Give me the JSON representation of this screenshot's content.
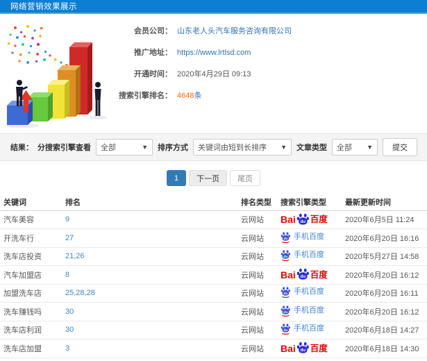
{
  "header": {
    "title": "网络营销效果展示"
  },
  "info": {
    "company_label": "会员公司：",
    "company_value": "山东老人头汽车服务咨询有限公司",
    "url_label": "推广地址：",
    "url_value": "https://www.lrtlsd.com",
    "open_label": "开通时间：",
    "open_value": "2020年4月29日 09:13",
    "rank_label": "搜索引擎排名：",
    "rank_count": "4648",
    "rank_unit": "条"
  },
  "filters": {
    "results_label": "结果：",
    "engine_filter_label": "分搜索引擎查看",
    "engine_filter_value": "全部",
    "sort_label": "排序方式",
    "sort_value": "关键词由短到长排序",
    "article_label": "文章类型",
    "article_value": "全部",
    "submit_label": "提交"
  },
  "pagination": {
    "current": "1",
    "next_label": "下一页",
    "last_label": "尾页"
  },
  "engines": {
    "baidu": {
      "prefix": "Bai",
      "paw_text": "du",
      "suffix": "百度"
    },
    "mobile": {
      "paw_text": "du",
      "label": "手机百度"
    }
  },
  "table": {
    "columns": [
      "关键词",
      "排名",
      "排名类型",
      "搜索引擎类型",
      "最新更新时间"
    ],
    "rows": [
      {
        "keyword": "汽车美容",
        "rank": "9",
        "rank_type": "云网站",
        "engine": "baidu",
        "updated": "2020年6月5日 11:24"
      },
      {
        "keyword": "开洗车行",
        "rank": "27",
        "rank_type": "云网站",
        "engine": "mobile",
        "updated": "2020年6月20日 16:16"
      },
      {
        "keyword": "洗车店投资",
        "rank": "21,26",
        "rank_type": "云网站",
        "engine": "mobile",
        "updated": "2020年5月27日 14:58"
      },
      {
        "keyword": "汽车加盟店",
        "rank": "8",
        "rank_type": "云网站",
        "engine": "baidu",
        "updated": "2020年6月20日 16:12"
      },
      {
        "keyword": "加盟洗车店",
        "rank": "25,28,28",
        "rank_type": "云网站",
        "engine": "mobile",
        "updated": "2020年6月20日 16:11"
      },
      {
        "keyword": "洗车赚钱吗",
        "rank": "30",
        "rank_type": "云网站",
        "engine": "mobile",
        "updated": "2020年6月20日 16:12"
      },
      {
        "keyword": "洗车店利润",
        "rank": "30",
        "rank_type": "云网站",
        "engine": "mobile",
        "updated": "2020年6月18日 14:27"
      },
      {
        "keyword": "洗车店加盟",
        "rank": "3",
        "rank_type": "云网站",
        "engine": "baidu",
        "updated": "2020年6月18日 14:30"
      }
    ]
  },
  "colors": {
    "header_blue": "#0d7fd2",
    "link_blue": "#3073b4",
    "rank_blue": "#3a87c8",
    "orange": "#ff6a00",
    "baidu_red": "#e10601",
    "baidu_blue": "#2629de",
    "active_page_blue": "#337ab7"
  }
}
